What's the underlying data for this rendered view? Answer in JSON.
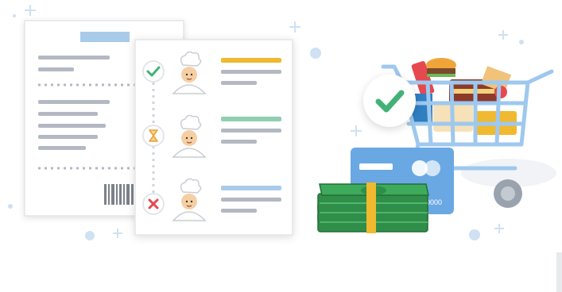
{
  "illustration": {
    "colors": {
      "line_gray": "#b3b8c2",
      "paper": "#ffffff",
      "paper_edge": "#e3e6ea",
      "header_blue": "#a9cbea",
      "status_bar_done": "#f0b92f",
      "status_bar_pending": "#8fcfb0",
      "status_bar_rejected": "#a9cbea",
      "check_green": "#43b276",
      "cross_red": "#e6484f",
      "hourglass_amber": "#e9a23a",
      "card_blue": "#6aa8e3",
      "cart_blue": "#9ec8ee",
      "cash_green": "#3dab5b",
      "sparkle_blue": "#cfe1f3"
    },
    "receipt": {
      "icons": [
        "barcode-icon"
      ]
    },
    "order_list": {
      "rows": [
        {
          "status_icon": "check-icon",
          "avatar_icon": "chef-avatar-icon"
        },
        {
          "status_icon": "hourglass-icon",
          "avatar_icon": "chef-avatar-icon"
        },
        {
          "status_icon": "cross-icon",
          "avatar_icon": "chef-avatar-icon"
        }
      ]
    },
    "shopping": {
      "icons": [
        "shopping-cart-icon",
        "checkmark-badge-icon",
        "credit-card-icon",
        "cash-stack-icon"
      ],
      "card_number": "0000"
    }
  }
}
